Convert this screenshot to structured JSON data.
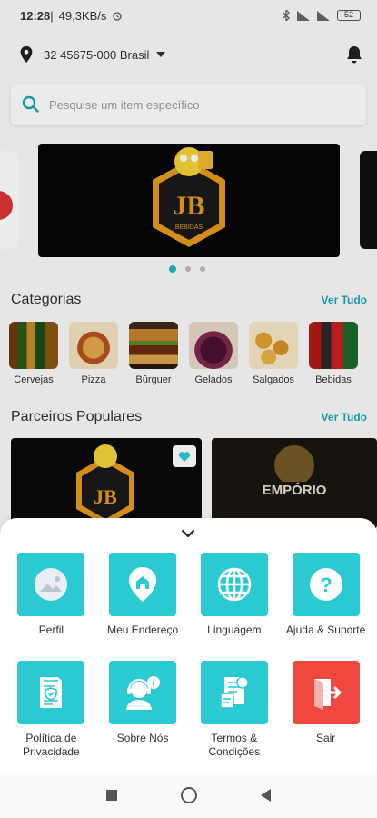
{
  "status_bar": {
    "time": "12:28",
    "speed": "49,3KB/s",
    "battery": "52"
  },
  "location": {
    "address": "32  45675-000 Brasil"
  },
  "search": {
    "placeholder": "Pesquise um item específico"
  },
  "banner": {
    "logo_text": "JB",
    "logo_subtext": "BEBIDAS",
    "active_index": 0,
    "count": 3
  },
  "categories": {
    "title": "Categorias",
    "see_all": "Ver Tudo",
    "items": [
      {
        "label": "Cervejas"
      },
      {
        "label": "Pizza"
      },
      {
        "label": "Bûrguer"
      },
      {
        "label": "Gelados"
      },
      {
        "label": "Salgados"
      },
      {
        "label": "Bebidas"
      }
    ]
  },
  "partners": {
    "title": "Parceiros Populares",
    "see_all": "Ver Tudo",
    "items": [
      {
        "logo_text": "JB"
      },
      {
        "logo_text": "EMPÓRIO"
      }
    ]
  },
  "menu": {
    "items": [
      {
        "label": "Perfil",
        "icon": "image-placeholder-icon"
      },
      {
        "label": "Meu Endereço",
        "icon": "home-pin-icon"
      },
      {
        "label": "Linguagem",
        "icon": "globe-icon"
      },
      {
        "label": "Ajuda & Suporte",
        "icon": "question-icon"
      },
      {
        "label": "Política de\nPrivacidade",
        "icon": "privacy-document-icon"
      },
      {
        "label": "Sobre Nós",
        "icon": "support-agent-icon"
      },
      {
        "label": "Termos &\nCondições",
        "icon": "terms-document-icon"
      },
      {
        "label": "Sair",
        "icon": "logout-door-icon"
      }
    ]
  },
  "colors": {
    "accent": "#2bcad3",
    "link": "#1aa7b1",
    "logout": "#f0483e"
  }
}
